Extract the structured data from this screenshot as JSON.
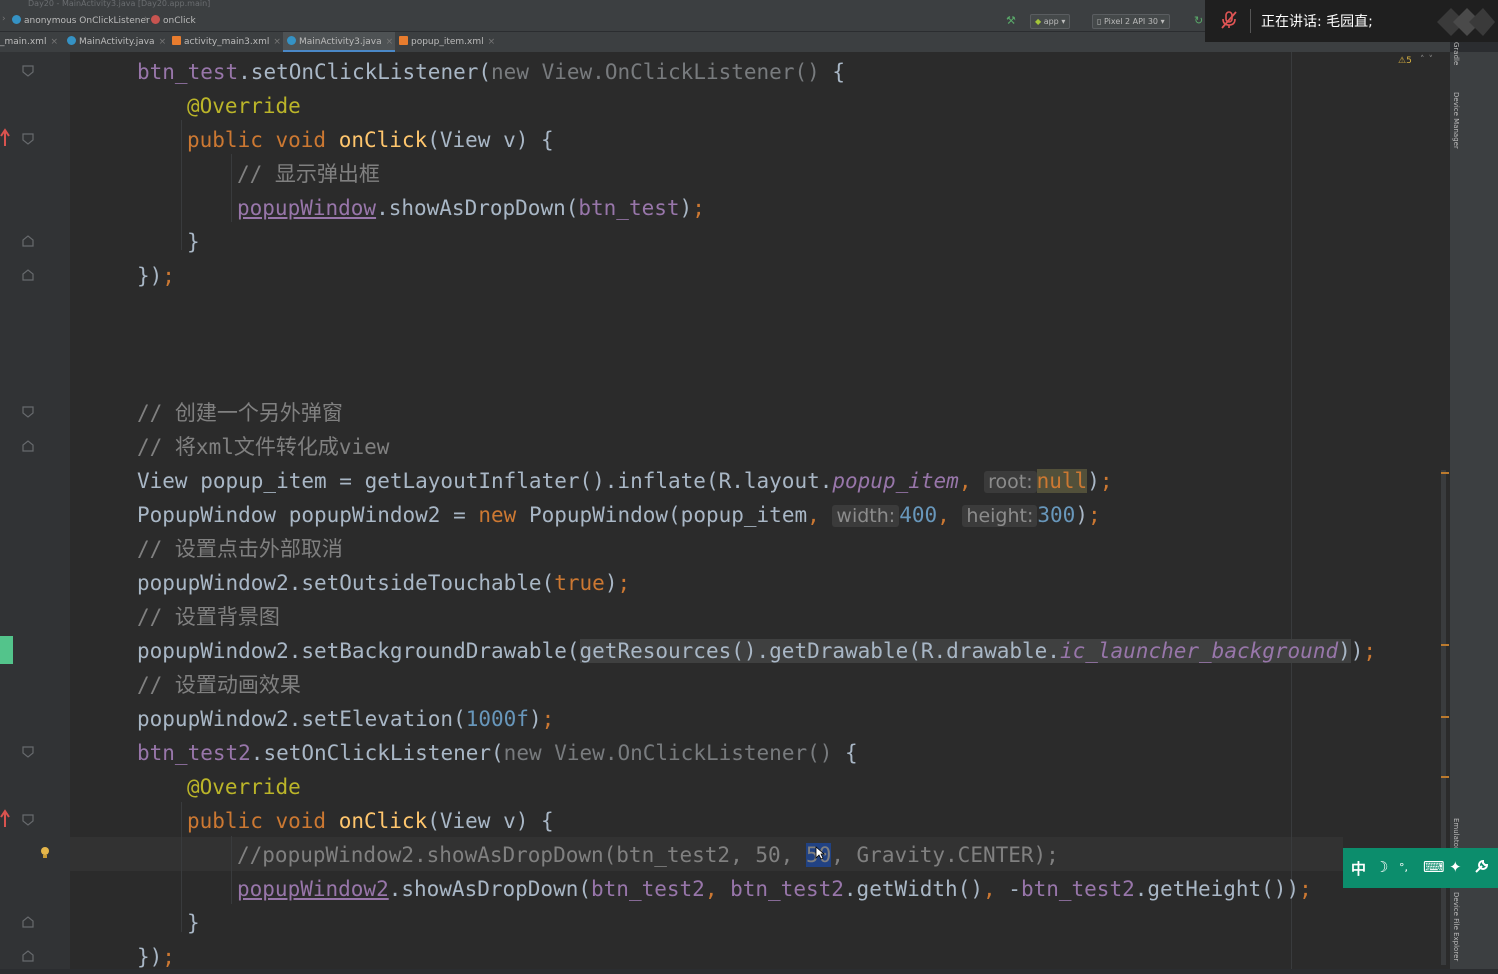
{
  "window": {
    "title": "Day20 - MainActivity3.java [Day20.app.main]"
  },
  "breadcrumb": {
    "items": [
      {
        "label": "anonymous OnClickListener",
        "icon": "class-icon"
      },
      {
        "label": "onClick",
        "icon": "method-icon"
      }
    ]
  },
  "toolbar": {
    "module": "app",
    "device": "Pixel 2 API 30"
  },
  "tabs": [
    {
      "label": "_main.xml",
      "active": false
    },
    {
      "label": "MainActivity.java",
      "active": false
    },
    {
      "label": "activity_main3.xml",
      "active": false
    },
    {
      "label": "MainActivity3.java",
      "active": true
    },
    {
      "label": "popup_item.xml",
      "active": false
    }
  ],
  "meeting": {
    "speaking_text": "正在讲话: 毛园直;"
  },
  "inspection": {
    "warning_count": "5"
  },
  "side_tools": {
    "gradle": "Gradle",
    "device_manager": "Device Manager",
    "emulator": "Emulator",
    "device_file_explorer": "Device File Explorer"
  },
  "ime": {
    "lang": "中",
    "mode": "☽",
    "punct": "°,",
    "keyboard": "⌨",
    "settings": "✦"
  },
  "code": {
    "l1": {
      "a": "btn_test",
      "b": ".setOnClickListener(",
      "c": "new ",
      "d": "View.OnClickListener() ",
      "e": "{"
    },
    "l2": {
      "a": "@Override"
    },
    "l3": {
      "a": "public void ",
      "b": "onClick",
      "c": "(View v) {"
    },
    "l4": {
      "a": "// 显示弹出框"
    },
    "l5": {
      "a": "popupWindow",
      "b": ".showAsDropDown(",
      "c": "btn_test",
      "d": ")",
      "e": ";"
    },
    "l6": {
      "a": "}"
    },
    "l7": {
      "a": "})",
      "b": ";"
    },
    "l8": {
      "a": "// 创建一个另外弹窗"
    },
    "l9": {
      "a": "// 将xml文件转化成view"
    },
    "l10": {
      "a": "View popup_item = getLayoutInflater().inflate(R.layout.",
      "b": "popup_item",
      "c": ", ",
      "hint": "root:",
      "d": "null",
      "e": ")",
      "f": ";"
    },
    "l11": {
      "a": "PopupWindow popupWindow2 = ",
      "b": "new ",
      "c": "PopupWindow(popup_item",
      "d": ", ",
      "hint1": "width:",
      "n1": "400",
      "e": ", ",
      "hint2": "height:",
      "n2": "300",
      "f": ")",
      "g": ";"
    },
    "l12": {
      "a": "// 设置点击外部取消"
    },
    "l13": {
      "a": "popupWindow2.setOutsideTouchable(",
      "b": "true",
      "c": ")",
      "d": ";"
    },
    "l14": {
      "a": "// 设置背景图"
    },
    "l15": {
      "a": "popupWindow2.setBackgroundDrawable(",
      "b": "getResources().getDrawable(R.drawable.",
      "c": "ic_launcher_background",
      "d": ")",
      "e": ")",
      "f": ";"
    },
    "l16": {
      "a": "// 设置动画效果"
    },
    "l17": {
      "a": "popupWindow2.setElevation(",
      "b": "1000f",
      "c": ")",
      "d": ";"
    },
    "l18": {
      "a": "btn_test2",
      "b": ".setOnClickListener(",
      "c": "new ",
      "d": "View.OnClickListener() ",
      "e": "{"
    },
    "l19": {
      "a": "@Override"
    },
    "l20": {
      "a": "public void ",
      "b": "onClick",
      "c": "(View v) {"
    },
    "l21": {
      "a": "//popupWindow2.showAsDropDown(btn_test2, 50, ",
      "b": "50",
      "c": ", Gravity.CENTER);"
    },
    "l22": {
      "a": "popupWindow2",
      "b": ".showAsDropDown(",
      "c": "btn_test2",
      "d": ", ",
      "e": "btn_test2",
      "f": ".getWidth()",
      "g": ", ",
      "h": "-",
      "i": "btn_test2",
      "j": ".getHeight())",
      "k": ";"
    },
    "l23": {
      "a": "}"
    },
    "l24": {
      "a": "})",
      "b": ";"
    }
  }
}
